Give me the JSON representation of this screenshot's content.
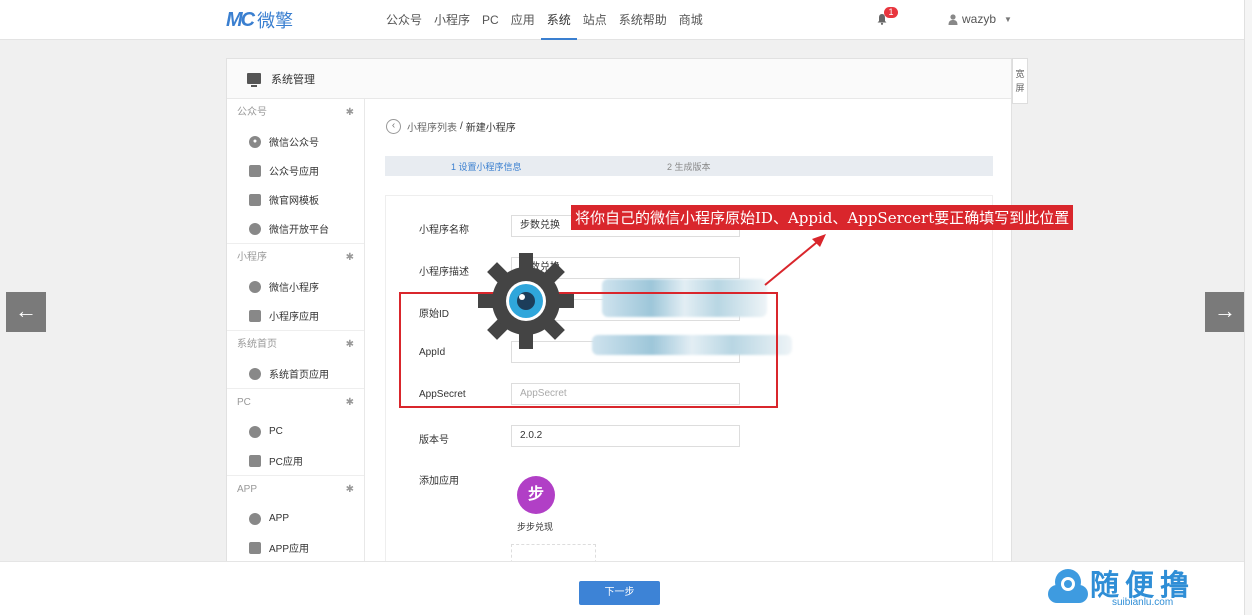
{
  "logo": {
    "mark": "MC",
    "name": "微擎"
  },
  "nav": [
    "公众号",
    "小程序",
    "PC",
    "应用",
    "系统",
    "站点",
    "系统帮助",
    "商城"
  ],
  "notifications": {
    "count": "1"
  },
  "user": {
    "name": "wazyb"
  },
  "panel": {
    "title": "系统管理",
    "side_tab": "宽屏"
  },
  "sidebar": [
    {
      "title": "公众号",
      "items": [
        "微信公众号",
        "公众号应用",
        "微官网模板",
        "微信开放平台"
      ]
    },
    {
      "title": "小程序",
      "items": [
        "微信小程序",
        "小程序应用"
      ]
    },
    {
      "title": "系统首页",
      "items": [
        "系统首页应用"
      ]
    },
    {
      "title": "PC",
      "items": [
        "PC",
        "PC应用"
      ]
    },
    {
      "title": "APP",
      "items": [
        "APP",
        "APP应用"
      ]
    }
  ],
  "breadcrumb": {
    "parent": "小程序列表",
    "separator": "/",
    "current": "新建小程序"
  },
  "steps": [
    "1 设置小程序信息",
    "2 生成版本"
  ],
  "form": {
    "name_label": "小程序名称",
    "name_value": "步数兑换",
    "desc_label": "小程序描述",
    "desc_value": "步数兑换",
    "origin_label": "原始ID",
    "appid_label": "AppId",
    "secret_label": "AppSecret",
    "secret_placeholder": "AppSecret",
    "version_label": "版本号",
    "version_value": "2.0.2",
    "addapp_label": "添加应用",
    "app_name": "步步兑现",
    "app_icon_char": "步"
  },
  "annotation": "将你自己的微信小程序原始ID、Appid、AppSercert要正确填写到此位置",
  "next_button": "下一步",
  "watermark": {
    "text": "随便撸",
    "url": "suibianlu.com"
  },
  "colors": {
    "accent": "#3a7fd0",
    "annotation": "#d9262c",
    "badge": "#e8353e"
  }
}
